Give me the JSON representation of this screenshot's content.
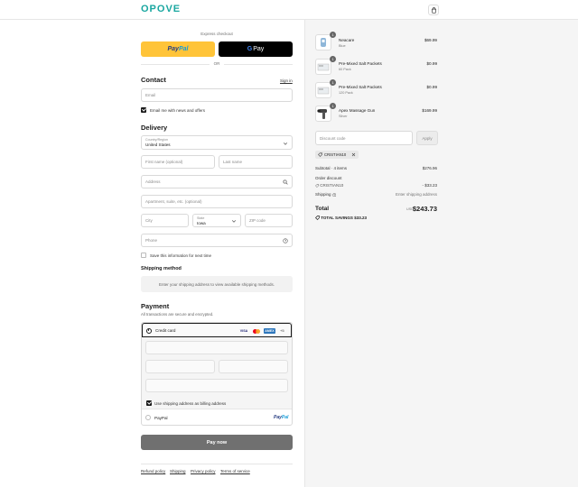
{
  "header": {
    "logo": "OPOVE"
  },
  "express": {
    "label": "Express checkout",
    "paypal_part1": "Pay",
    "paypal_part2": "Pal",
    "gpay_g": "G",
    "gpay_label": "Pay",
    "or": "OR"
  },
  "contact": {
    "title": "Contact",
    "sign_in": "Sign in",
    "email_placeholder": "Email",
    "news_label": "Email me with news and offers"
  },
  "delivery": {
    "title": "Delivery",
    "country_label": "Country/Region",
    "country_value": "United States",
    "first_name": "First name (optional)",
    "last_name": "Last name",
    "address": "Address",
    "apartment": "Apartment, suite, etc. (optional)",
    "city": "City",
    "state_label": "State",
    "state_value": "Iowa",
    "zip": "ZIP code",
    "phone": "Phone",
    "save_label": "Save this information for next time"
  },
  "shipping": {
    "title": "Shipping method",
    "note": "Enter your shipping address to view available shipping methods."
  },
  "payment": {
    "title": "Payment",
    "subtitle": "All transactions are secure and encrypted.",
    "credit_card": "Credit card",
    "visa": "VISA",
    "amex": "AMEX",
    "more_cards": "+5",
    "billing_label": "Use shipping address as billing address",
    "paypal_option": "PayPal",
    "paypal_logo_1": "Pay",
    "paypal_logo_2": "Pal",
    "pay_now": "Pay now"
  },
  "footer": {
    "links": [
      "Refund policy",
      "Shipping",
      "Privacy policy",
      "Terms of service"
    ]
  },
  "cart": {
    "items": [
      {
        "qty": "1",
        "name": "Neacare",
        "variant": "Blue",
        "price": "$69.99",
        "icon": "neck-massager-thumb"
      },
      {
        "qty": "1",
        "name": "Pre-Mixed Salt Packets",
        "variant": "60 Pack",
        "price": "$0.99",
        "icon": "salt-packets-thumb"
      },
      {
        "qty": "1",
        "name": "Pre-Mixed Salt Packets",
        "variant": "120 Pack",
        "price": "$0.99",
        "icon": "salt-packets-thumb"
      },
      {
        "qty": "1",
        "name": "Apex Massage Gun",
        "variant": "Silver",
        "price": "$169.99",
        "icon": "massage-gun-thumb"
      }
    ],
    "discount_placeholder": "Discount code",
    "apply": "Apply",
    "applied_code": "CRISTIAN10",
    "subtotal_label": "Subtotal · 4 items",
    "subtotal_value": "$276.96",
    "order_discount_label": "Order discount",
    "discount_code": "CRISTIAN10",
    "discount_value": "- $33.23",
    "shipping_label": "Shipping",
    "shipping_value": "Enter shipping address",
    "total_label": "Total",
    "currency": "USD",
    "total_value": "$243.73",
    "savings_label": "TOTAL SAVINGS",
    "savings_value": "$33.23"
  },
  "colors": {
    "brand": "#1aa7a0",
    "paypal_yellow": "#ffc439",
    "pay_button": "#707070"
  }
}
